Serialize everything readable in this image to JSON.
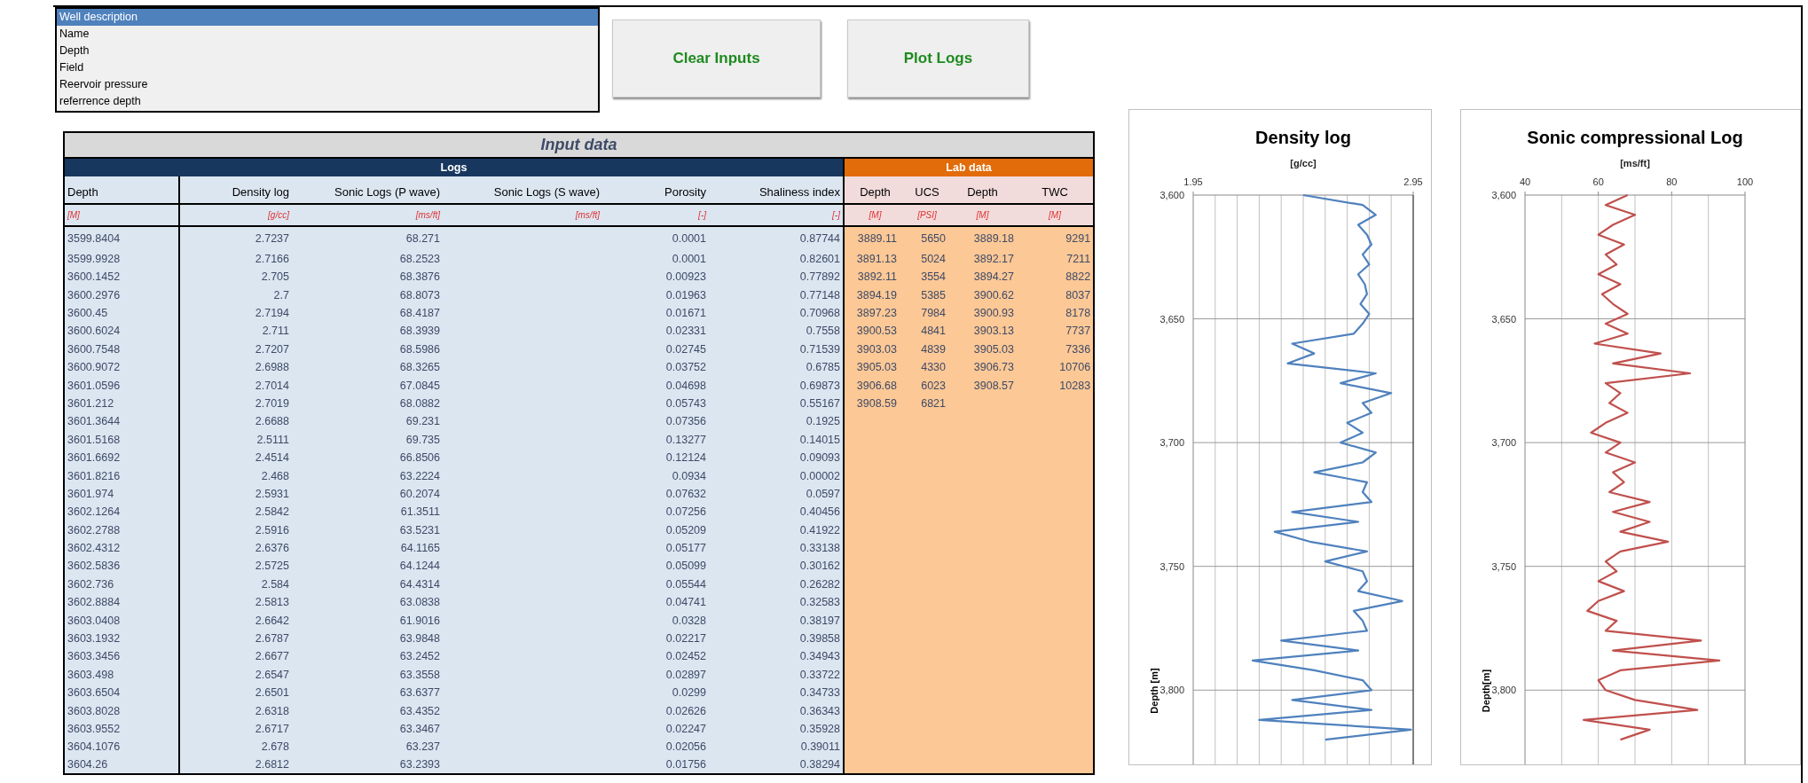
{
  "list_box": {
    "items": [
      {
        "label": "Well description",
        "selected": true
      },
      {
        "label": "Name",
        "selected": false
      },
      {
        "label": "Depth",
        "selected": false
      },
      {
        "label": "Field",
        "selected": false
      },
      {
        "label": "Reervoir pressure",
        "selected": false
      },
      {
        "label": "referrence depth",
        "selected": false
      }
    ]
  },
  "buttons": [
    {
      "label": "Clear Inputs"
    },
    {
      "label": "Plot Logs"
    }
  ],
  "table": {
    "title": "Input data",
    "groups": [
      {
        "label": "Logs",
        "kind": "logs",
        "columns": [
          {
            "label": "Depth",
            "unit": "[M]"
          },
          {
            "label": "Density log",
            "unit": "[g/cc]"
          },
          {
            "label": "Sonic Logs (P wave)",
            "unit": "[ms/ft]"
          },
          {
            "label": "Sonic Logs (S wave)",
            "unit": "[ms/ft]"
          },
          {
            "label": "Porosity",
            "unit": "[-]"
          },
          {
            "label": "Shaliness index",
            "unit": "[-]"
          }
        ]
      },
      {
        "label": "Lab data",
        "kind": "lab",
        "columns": [
          {
            "label": "Depth",
            "unit": "[M]"
          },
          {
            "label": "UCS",
            "unit": "[PSI]"
          },
          {
            "label": "Depth",
            "unit": "[M]"
          },
          {
            "label": "TWC",
            "unit": "[M]"
          }
        ]
      }
    ],
    "rows": [
      [
        "3599.8404",
        "2.7237",
        "68.271",
        null,
        "0.0001",
        "0.87744"
      ],
      [
        "3599.9928",
        "2.7166",
        "68.2523",
        null,
        "0.0001",
        "0.82601"
      ],
      [
        "3600.1452",
        "2.705",
        "68.3876",
        null,
        "0.00923",
        "0.77892"
      ],
      [
        "3600.2976",
        "2.7",
        "68.8073",
        null,
        "0.01963",
        "0.77148"
      ],
      [
        "3600.45",
        "2.7194",
        "68.4187",
        null,
        "0.01671",
        "0.70968"
      ],
      [
        "3600.6024",
        "2.711",
        "68.3939",
        null,
        "0.02331",
        "0.7558"
      ],
      [
        "3600.7548",
        "2.7207",
        "68.5986",
        null,
        "0.02745",
        "0.71539"
      ],
      [
        "3600.9072",
        "2.6988",
        "68.3265",
        null,
        "0.03752",
        "0.6785"
      ],
      [
        "3601.0596",
        "2.7014",
        "67.0845",
        null,
        "0.04698",
        "0.69873"
      ],
      [
        "3601.212",
        "2.7019",
        "68.0882",
        null,
        "0.05743",
        "0.55167"
      ],
      [
        "3601.3644",
        "2.6688",
        "69.231",
        null,
        "0.07356",
        "0.1925"
      ],
      [
        "3601.5168",
        "2.5111",
        "69.735",
        null,
        "0.13277",
        "0.14015"
      ],
      [
        "3601.6692",
        "2.4514",
        "66.8506",
        null,
        "0.12124",
        "0.09093"
      ],
      [
        "3601.8216",
        "2.468",
        "63.2224",
        null,
        "0.0934",
        "0.00002"
      ],
      [
        "3601.974",
        "2.5931",
        "60.2074",
        null,
        "0.07632",
        "0.0597"
      ],
      [
        "3602.1264",
        "2.5842",
        "61.3511",
        null,
        "0.07256",
        "0.40456"
      ],
      [
        "3602.2788",
        "2.5916",
        "63.5231",
        null,
        "0.05209",
        "0.41922"
      ],
      [
        "3602.4312",
        "2.6376",
        "64.1165",
        null,
        "0.05177",
        "0.33138"
      ],
      [
        "3602.5836",
        "2.5725",
        "64.1244",
        null,
        "0.05099",
        "0.30162"
      ],
      [
        "3602.736",
        "2.584",
        "64.4314",
        null,
        "0.05544",
        "0.26282"
      ],
      [
        "3602.8884",
        "2.5813",
        "63.0838",
        null,
        "0.04741",
        "0.32583"
      ],
      [
        "3603.0408",
        "2.6642",
        "61.9016",
        null,
        "0.0328",
        "0.38197"
      ],
      [
        "3603.1932",
        "2.6787",
        "63.9848",
        null,
        "0.02217",
        "0.39858"
      ],
      [
        "3603.3456",
        "2.6677",
        "63.2452",
        null,
        "0.02452",
        "0.34943"
      ],
      [
        "3603.498",
        "2.6547",
        "63.3558",
        null,
        "0.02897",
        "0.33722"
      ],
      [
        "3603.6504",
        "2.6501",
        "63.6377",
        null,
        "0.0299",
        "0.34733"
      ],
      [
        "3603.8028",
        "2.6318",
        "63.4352",
        null,
        "0.02626",
        "0.36343"
      ],
      [
        "3603.9552",
        "2.6717",
        "63.3467",
        null,
        "0.02247",
        "0.35928"
      ],
      [
        "3604.1076",
        "2.678",
        "63.237",
        null,
        "0.02056",
        "0.39011"
      ],
      [
        "3604.26",
        "2.6812",
        "63.2393",
        null,
        "0.01756",
        "0.38294"
      ]
    ],
    "lab_rows": [
      [
        "3889.11",
        "5650",
        "3889.18",
        "9291"
      ],
      [
        "3891.13",
        "5024",
        "3892.17",
        "7211"
      ],
      [
        "3892.11",
        "3554",
        "3894.27",
        "8822"
      ],
      [
        "3894.19",
        "5385",
        "3900.62",
        "8037"
      ],
      [
        "3897.23",
        "7984",
        "3900.93",
        "8178"
      ],
      [
        "3900.53",
        "4841",
        "3903.13",
        "7737"
      ],
      [
        "3903.03",
        "4839",
        "3905.03",
        "7336"
      ],
      [
        "3905.03",
        "4330",
        "3906.73",
        "10706"
      ],
      [
        "3906.68",
        "6023",
        "3908.57",
        "10283"
      ],
      [
        "3908.59",
        "6821"
      ]
    ]
  },
  "charts": [
    {
      "chart_data": {
        "type": "line",
        "title": "Density log",
        "xlabel": "[g/cc]",
        "ylabel": "Depth [m]",
        "xlim": [
          1.95,
          2.95
        ],
        "ylim": [
          3830,
          3600
        ],
        "xticks": [
          1.95,
          2.95
        ],
        "yticks": [
          {
            "value": 3600,
            "label": "3,600"
          },
          {
            "value": 3650,
            "label": "3,650"
          },
          {
            "value": 3700,
            "label": "3,700"
          },
          {
            "value": 3750,
            "label": "3,750"
          },
          {
            "value": 3800,
            "label": "3,800"
          }
        ],
        "x": [
          2.45,
          2.72,
          2.78,
          2.7,
          2.74,
          2.76,
          2.72,
          2.75,
          2.7,
          2.73,
          2.74,
          2.71,
          2.75,
          2.72,
          2.68,
          2.4,
          2.5,
          2.38,
          2.78,
          2.62,
          2.85,
          2.72,
          2.76,
          2.65,
          2.72,
          2.62,
          2.78,
          2.72,
          2.5,
          2.74,
          2.72,
          2.76,
          2.4,
          2.7,
          2.32,
          2.48,
          2.74,
          2.55,
          2.72,
          2.74,
          2.7,
          2.9,
          2.68,
          2.72,
          2.74,
          2.35,
          2.7,
          2.22,
          2.5,
          2.72,
          2.76,
          2.4,
          2.76,
          2.25,
          2.94,
          2.55
        ],
        "grid": true,
        "series": [
          {
            "color": "#4f81bd",
            "values": [
              3600,
              3604,
              3608,
              3612,
              3616,
              3620,
              3624,
              3628,
              3632,
              3636,
              3640,
              3644,
              3648,
              3652,
              3656,
              3660,
              3664,
              3668,
              3672,
              3676,
              3680,
              3684,
              3688,
              3692,
              3696,
              3700,
              3704,
              3708,
              3712,
              3716,
              3720,
              3724,
              3728,
              3732,
              3736,
              3740,
              3744,
              3748,
              3752,
              3756,
              3760,
              3764,
              3768,
              3772,
              3776,
              3780,
              3784,
              3788,
              3792,
              3796,
              3800,
              3804,
              3808,
              3812,
              3816,
              3820
            ]
          }
        ]
      }
    },
    {
      "chart_data": {
        "type": "line",
        "title": "Sonic compressional Log",
        "xlabel": "[ms/ft]",
        "ylabel": "Depth[m]",
        "xlim": [
          40,
          100
        ],
        "ylim": [
          3830,
          3600
        ],
        "xticks": [
          40,
          60,
          80,
          100
        ],
        "yticks": [
          {
            "value": 3600,
            "label": "3,600"
          },
          {
            "value": 3650,
            "label": "3,650"
          },
          {
            "value": 3700,
            "label": "3,700"
          },
          {
            "value": 3750,
            "label": "3,750"
          },
          {
            "value": 3800,
            "label": "3,800"
          }
        ],
        "x": [
          68,
          62,
          70,
          64,
          60,
          67,
          62,
          65,
          60,
          66,
          61,
          64,
          68,
          62,
          68,
          59,
          77,
          64,
          85,
          62,
          66,
          63,
          68,
          62,
          58,
          66,
          62,
          70,
          64,
          67,
          63,
          74,
          64,
          74,
          66,
          79,
          66,
          62,
          65,
          60,
          67,
          60,
          57,
          65,
          62,
          88,
          64,
          93,
          66,
          60,
          62,
          70,
          87,
          56,
          74,
          66
        ],
        "grid": true,
        "series": [
          {
            "color": "#c0504d",
            "values": [
              3600,
              3604,
              3608,
              3612,
              3616,
              3620,
              3624,
              3628,
              3632,
              3636,
              3640,
              3644,
              3648,
              3652,
              3656,
              3660,
              3664,
              3668,
              3672,
              3676,
              3680,
              3684,
              3688,
              3692,
              3696,
              3700,
              3704,
              3708,
              3712,
              3716,
              3720,
              3724,
              3728,
              3732,
              3736,
              3740,
              3744,
              3748,
              3752,
              3756,
              3760,
              3764,
              3768,
              3772,
              3776,
              3780,
              3784,
              3788,
              3792,
              3796,
              3800,
              3804,
              3808,
              3812,
              3816,
              3820
            ]
          }
        ]
      }
    }
  ]
}
